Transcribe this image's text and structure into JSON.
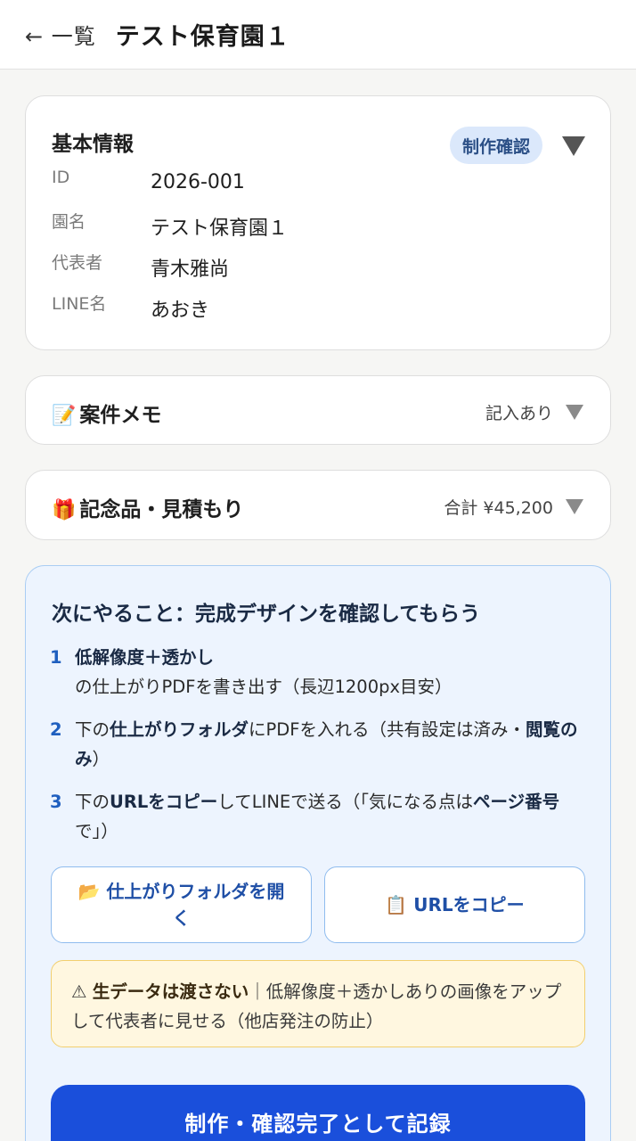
{
  "header": {
    "back_label": "← 一覧",
    "title": "テスト保育園１"
  },
  "basic_info": {
    "title": "基本情報",
    "status": "制作確認",
    "rows": [
      {
        "label": "ID",
        "value": "2026-001"
      },
      {
        "label": "園名",
        "value": "テスト保育園１"
      },
      {
        "label": "代表者",
        "value": "青木雅尚"
      },
      {
        "label": "LINE名",
        "value": "あおき"
      }
    ]
  },
  "memo": {
    "icon": "memo-icon",
    "emoji": "📝",
    "title": "案件メモ",
    "status": "記入あり"
  },
  "gift": {
    "icon": "gift-icon",
    "emoji": "🎁",
    "title": "記念品・見積もり",
    "total": "合計 ¥45,200"
  },
  "next": {
    "title": "次にやること：完成デザインを確認してもらう",
    "steps": [
      {
        "num": "1",
        "bold1": "低解像度＋透かし",
        "text1": "の仕上がりPDFを書き出す（長辺1200px目安）"
      },
      {
        "num": "2",
        "text0": "下の",
        "bold1": "仕上がりフォルダ",
        "text1": "にPDFを入れる（共有設定は済み・",
        "bold2": "閲覧のみ",
        "text2": "）"
      },
      {
        "num": "3",
        "text0": "下の",
        "bold1": "URLをコピー",
        "text1": "してLINEで送る（「気になる点は",
        "bold2": "ページ番号",
        "text2": "で」）"
      }
    ],
    "folder_button": {
      "emoji": "📂",
      "label": "仕上がりフォルダを開く"
    },
    "copy_button": {
      "emoji": "📋",
      "label": "URLをコピー"
    },
    "warning": {
      "icon": "warning-icon",
      "bold": "生データは渡さない",
      "text": "｜低解像度＋透かしありの画像をアップして代表者に見せる（他店発注の防止）"
    },
    "primary_button": "制作・確認完了として記録"
  },
  "colors": {
    "primary": "#1a4fdb",
    "badge_bg": "#dbe8fb",
    "next_bg": "#edf4fe",
    "warning_bg": "#fff7e0"
  }
}
